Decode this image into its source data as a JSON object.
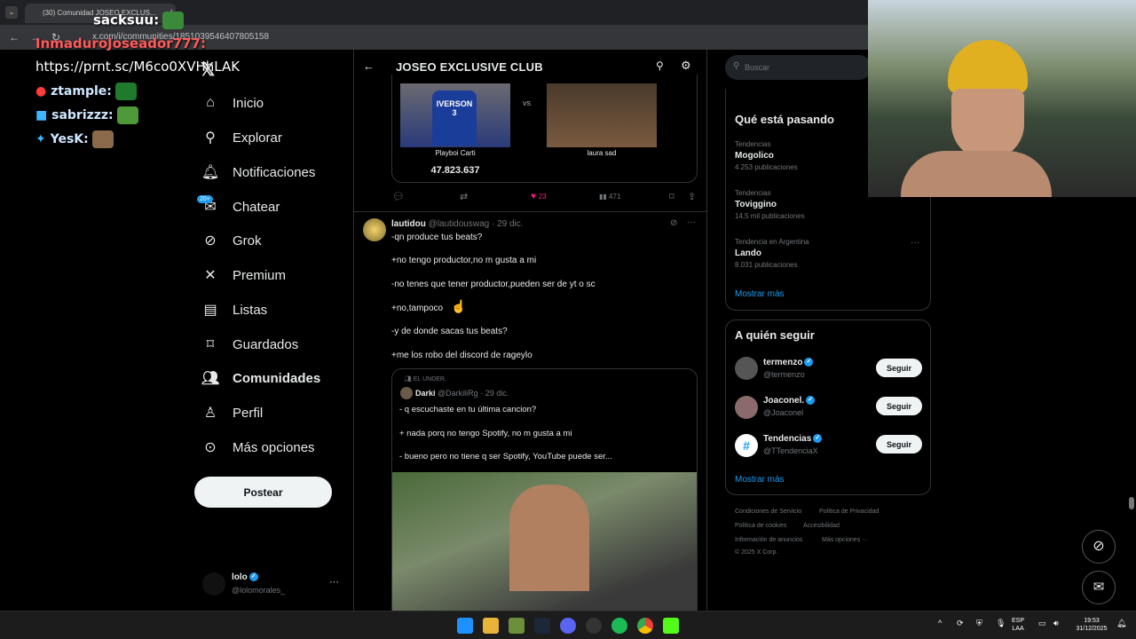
{
  "browser": {
    "tab_title": "(30) Comunidad JOSEO EXCLUS...",
    "url": "x.com/i/communities/1851039546407805158"
  },
  "overlay": {
    "user_line": "InmaduroJoseador777:",
    "link": "https://prnt.sc/M6co0XVHhLAK",
    "chat_top": "sacksuu:",
    "chat": [
      {
        "name": "ztample:"
      },
      {
        "name": "sabrizzz:"
      },
      {
        "name": "YesK:"
      }
    ]
  },
  "sidebar": {
    "items": [
      {
        "label": "Inicio",
        "icon": "home-icon"
      },
      {
        "label": "Explorar",
        "icon": "search-icon"
      },
      {
        "label": "Notificaciones",
        "icon": "bell-icon"
      },
      {
        "label": "Chatear",
        "icon": "chat-icon"
      },
      {
        "label": "Grok",
        "icon": "grok-icon"
      },
      {
        "label": "Premium",
        "icon": "x-logo-icon"
      },
      {
        "label": "Listas",
        "icon": "list-icon"
      },
      {
        "label": "Guardados",
        "icon": "bookmark-icon"
      },
      {
        "label": "Comunidades",
        "icon": "communities-icon"
      },
      {
        "label": "Perfil",
        "icon": "person-icon"
      },
      {
        "label": "Más opciones",
        "icon": "more-circle-icon"
      }
    ],
    "chat_badge": "20+",
    "post_label": "Postear",
    "account": {
      "name": "lolo",
      "handle": "@lolomorales_"
    }
  },
  "main": {
    "title": "JOSEO EXCLUSIVE CLUB",
    "poll_card": {
      "left_name": "Playboi Carti",
      "left_count": "47.823.637",
      "vs": "vs",
      "right_name": "laura sad"
    },
    "actions": {
      "likes": "23",
      "views": "471"
    },
    "tweet": {
      "name": "lautidou",
      "handle": "@lautidouswag",
      "date": "· 29 dic.",
      "lines": [
        "-qn produce tus beats?",
        "+no tengo productor,no m gusta a mi",
        "-no tenes que tener productor,pueden ser de yt o sc",
        "+no,tampoco",
        "-y de donde sacas tus beats?",
        "+me los robo del discord de rageylo"
      ],
      "quote": {
        "community": "EL UNDER.",
        "name": "Darki",
        "handle": "@DarkiliRg",
        "date": "· 29 dic.",
        "lines": [
          "- q escuchaste en tu última cancion?",
          "+ nada porq no tengo Spotify, no m gusta a mi",
          "- bueno pero no tiene q ser Spotify, YouTube puede ser..."
        ]
      }
    }
  },
  "right": {
    "search_placeholder": "Buscar",
    "trends_title": "Qué está pasando",
    "trends": [
      {
        "category": "Tendencias",
        "name": "Mogolico",
        "count": "4.253 publicaciones"
      },
      {
        "category": "Tendencias",
        "name": "Toviggino",
        "count": "14,5 mil publicaciones"
      },
      {
        "category": "Tendencia en Argentina",
        "name": "Lando",
        "count": "8.031 publicaciones"
      }
    ],
    "show_more": "Mostrar más",
    "follow_title": "A quién seguir",
    "follow": [
      {
        "name": "termenzo",
        "handle": "@termenzo"
      },
      {
        "name": "Joaconel.",
        "handle": "@Joaconel"
      },
      {
        "name": "Tendencias",
        "handle": "@TTendenciaX"
      }
    ],
    "follow_label": "Seguir",
    "show_more2": "Mostrar más",
    "footer": [
      "Condiciones de Servicio",
      "Política de Privacidad",
      "Política de cookies",
      "Accesibilidad",
      "Información de anuncios",
      "Más opciones ···",
      "© 2025 X Corp."
    ]
  },
  "taskbar": {
    "lang": "ESP",
    "lang2": "LAA",
    "time": "19:53",
    "date": "31/12/2025"
  }
}
